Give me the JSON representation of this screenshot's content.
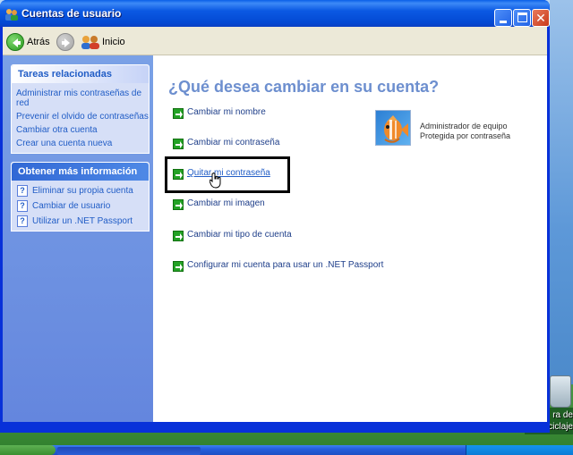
{
  "window": {
    "title": "Cuentas de usuario"
  },
  "toolbar": {
    "back_label": "Atrás",
    "home_label": "Inicio"
  },
  "taskpane": {
    "related_tasks": {
      "header": "Tareas relacionadas",
      "items": [
        "Administrar mis contraseñas de red",
        "Prevenir el olvido de contraseñas",
        "Cambiar otra cuenta",
        "Crear una cuenta nueva"
      ]
    },
    "more_info": {
      "header": "Obtener más información",
      "items": [
        "Eliminar su propia cuenta",
        "Cambiar de usuario",
        "Utilizar un .NET Passport"
      ]
    }
  },
  "main": {
    "heading": "¿Qué desea cambiar en su cuenta?",
    "options": [
      "Cambiar mi nombre",
      "Cambiar mi contraseña",
      "Quitar mi contraseña",
      "Cambiar mi imagen",
      "Cambiar mi tipo de cuenta",
      "Configurar mi cuenta para usar un .NET Passport"
    ],
    "highlighted_option": "Quitar mi contraseña",
    "account": {
      "type": "Administrador de equipo",
      "status": "Protegida por contraseña",
      "picture": "fish-picture"
    }
  },
  "desktop": {
    "recycle_label_line1": "ra de",
    "recycle_label_line2": "reciclaje"
  },
  "colors": {
    "title_blue": "#0349d3",
    "task_link": "#215dc6",
    "heading": "#6d8fcf",
    "arrow_green": "#23a225"
  }
}
